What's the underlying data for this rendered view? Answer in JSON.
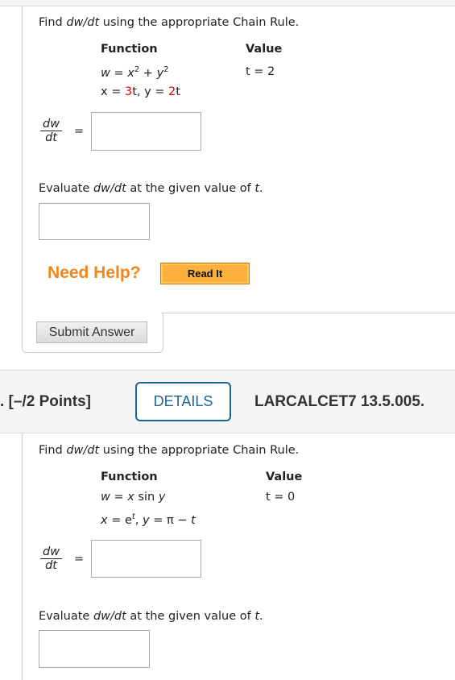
{
  "q1": {
    "prompt_pre": "Find ",
    "prompt_var": "dw/dt",
    "prompt_post": " using the appropriate Chain Rule.",
    "function_header": "Function",
    "value_header": "Value",
    "func_line1": "w = x² + y²",
    "func_line2": {
      "a": "x = ",
      "c1": "3",
      "b": "t, y = ",
      "c2": "2",
      "c": "t"
    },
    "value": "t = 2",
    "frac_num": "dw",
    "frac_den": "dt",
    "equals": "=",
    "evaluate_pre": "Evaluate ",
    "evaluate_var": "dw/dt",
    "evaluate_mid": " at the given value of ",
    "evaluate_t": "t",
    "evaluate_end": ".",
    "need_help": "Need Help?",
    "read_it": "Read It",
    "submit": "Submit Answer"
  },
  "q2_header": {
    "points": ". [–/2 Points]",
    "details": "DETAILS",
    "code": "LARCALCET7 13.5.005."
  },
  "q2": {
    "prompt_pre": "Find ",
    "prompt_var": "dw/dt",
    "prompt_post": " using the appropriate Chain Rule.",
    "function_header": "Function",
    "value_header": "Value",
    "func_line1": "w = x sin y",
    "func_line2": "x = eᵗ, y = π − t",
    "value": "t = 0",
    "frac_num": "dw",
    "frac_den": "dt",
    "equals": "=",
    "evaluate_pre": "Evaluate ",
    "evaluate_var": "dw/dt",
    "evaluate_mid": " at the given value of ",
    "evaluate_t": "t",
    "evaluate_end": "."
  },
  "colors": {
    "red": "#e00000",
    "help": "#f0861e",
    "details": "#1a6496",
    "readit": "#fbb03b"
  }
}
